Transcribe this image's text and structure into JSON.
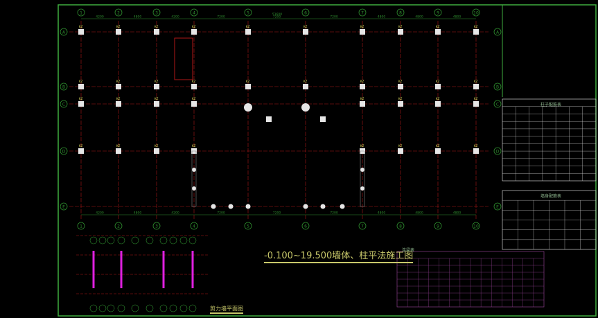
{
  "drawing": {
    "title": "-0.100~19.500墙体、柱平法施工图",
    "legend_title": "剪力墙平面图",
    "table1_title": "柱子配筋表",
    "table2_title": "墙身配筋表",
    "table3_title": "连梁表",
    "total_dimension": "51600",
    "axis_columns": [
      "1",
      "2",
      "3",
      "4",
      "5",
      "6",
      "7",
      "8",
      "9",
      "10"
    ],
    "axis_rows": [
      "A",
      "B",
      "C",
      "D",
      "E"
    ],
    "column_spacings": [
      "4200",
      "4800",
      "4200",
      "7200",
      "7200",
      "7200",
      "4800",
      "4800",
      "4800"
    ],
    "colors": {
      "frame": "#3fae3f",
      "grid": "#b01818",
      "axis": "#2f8f2f",
      "column": "#e6e6e6",
      "wall": "#e020e0",
      "text": "#c8c86a"
    }
  }
}
